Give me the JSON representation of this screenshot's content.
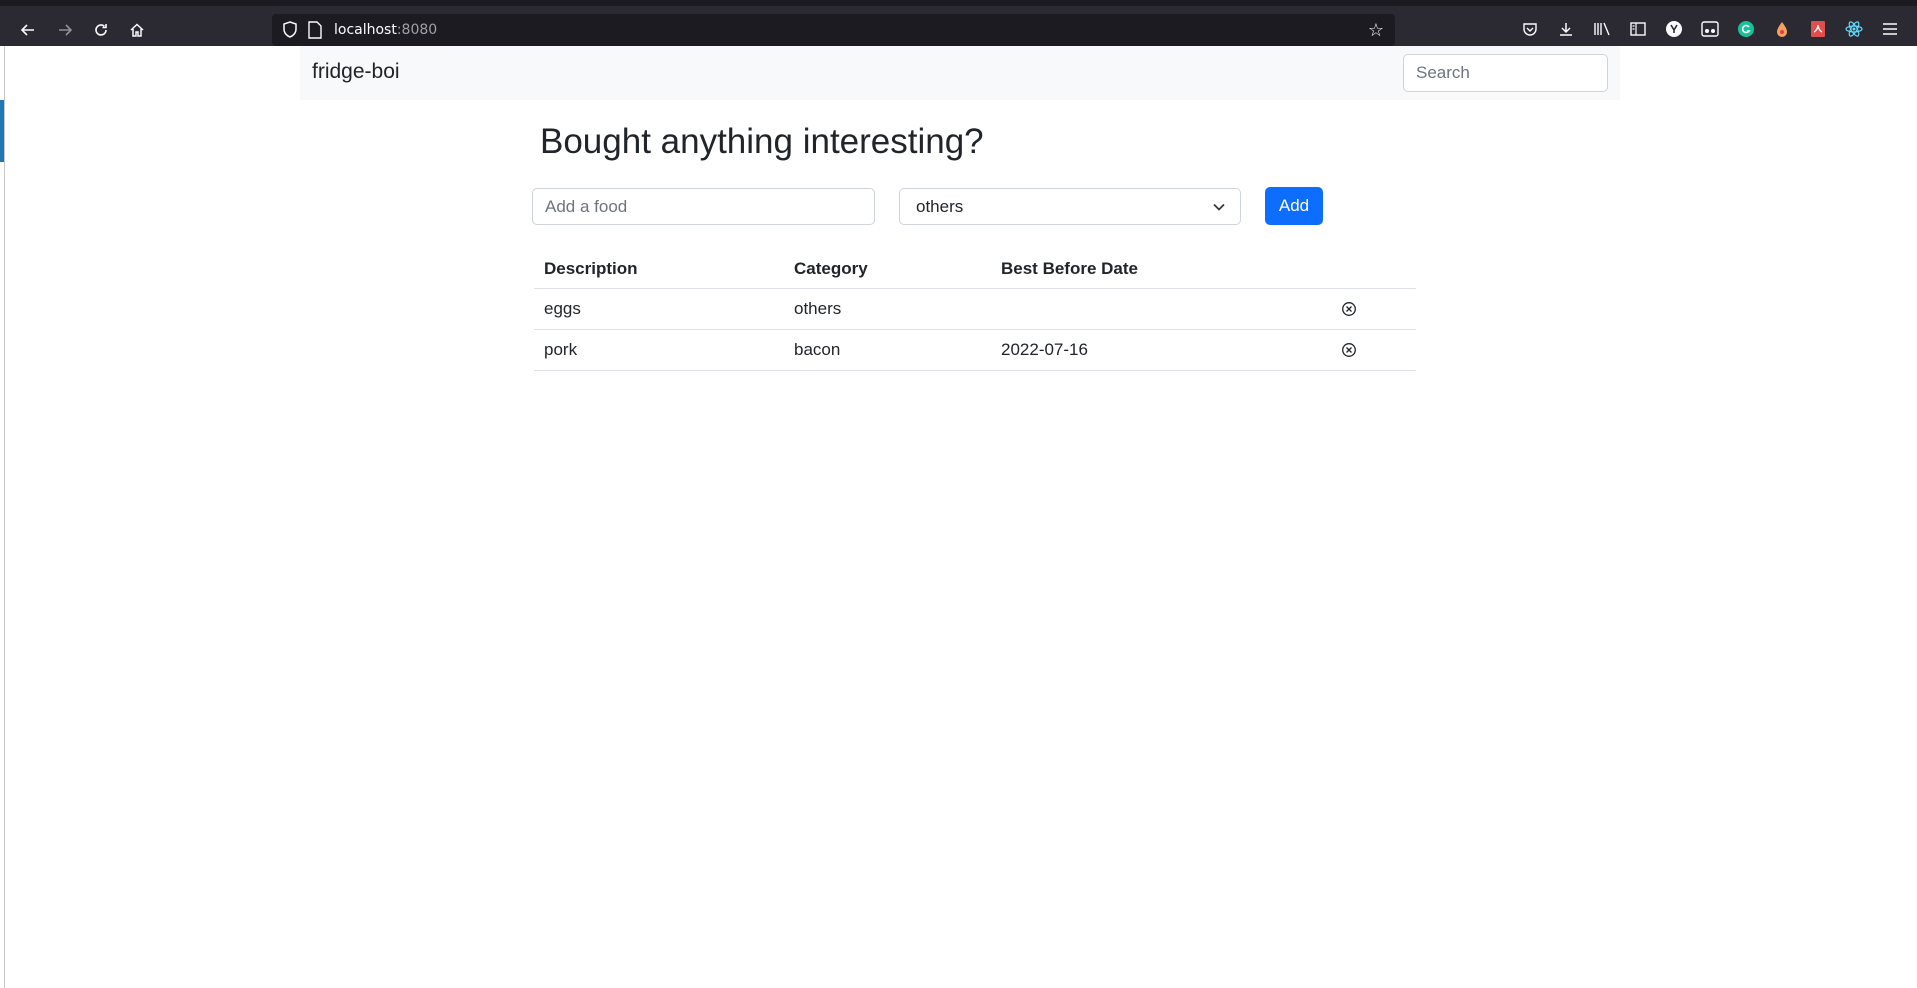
{
  "browser": {
    "url_host": "localhost",
    "url_port": ":8080"
  },
  "navbar": {
    "brand": "fridge-boi",
    "search_placeholder": "Search"
  },
  "main": {
    "title": "Bought anything interesting?",
    "food_placeholder": "Add a food",
    "category_selected": "others",
    "add_label": "Add"
  },
  "table": {
    "headers": [
      "Description",
      "Category",
      "Best Before Date"
    ],
    "rows": [
      {
        "description": "eggs",
        "category": "others",
        "best_before": ""
      },
      {
        "description": "pork",
        "category": "bacon",
        "best_before": "2022-07-16"
      }
    ]
  },
  "colors": {
    "primary": "#0d6efd",
    "navbar_bg": "#f8f9fa",
    "browser_bg": "#2b2a33"
  }
}
